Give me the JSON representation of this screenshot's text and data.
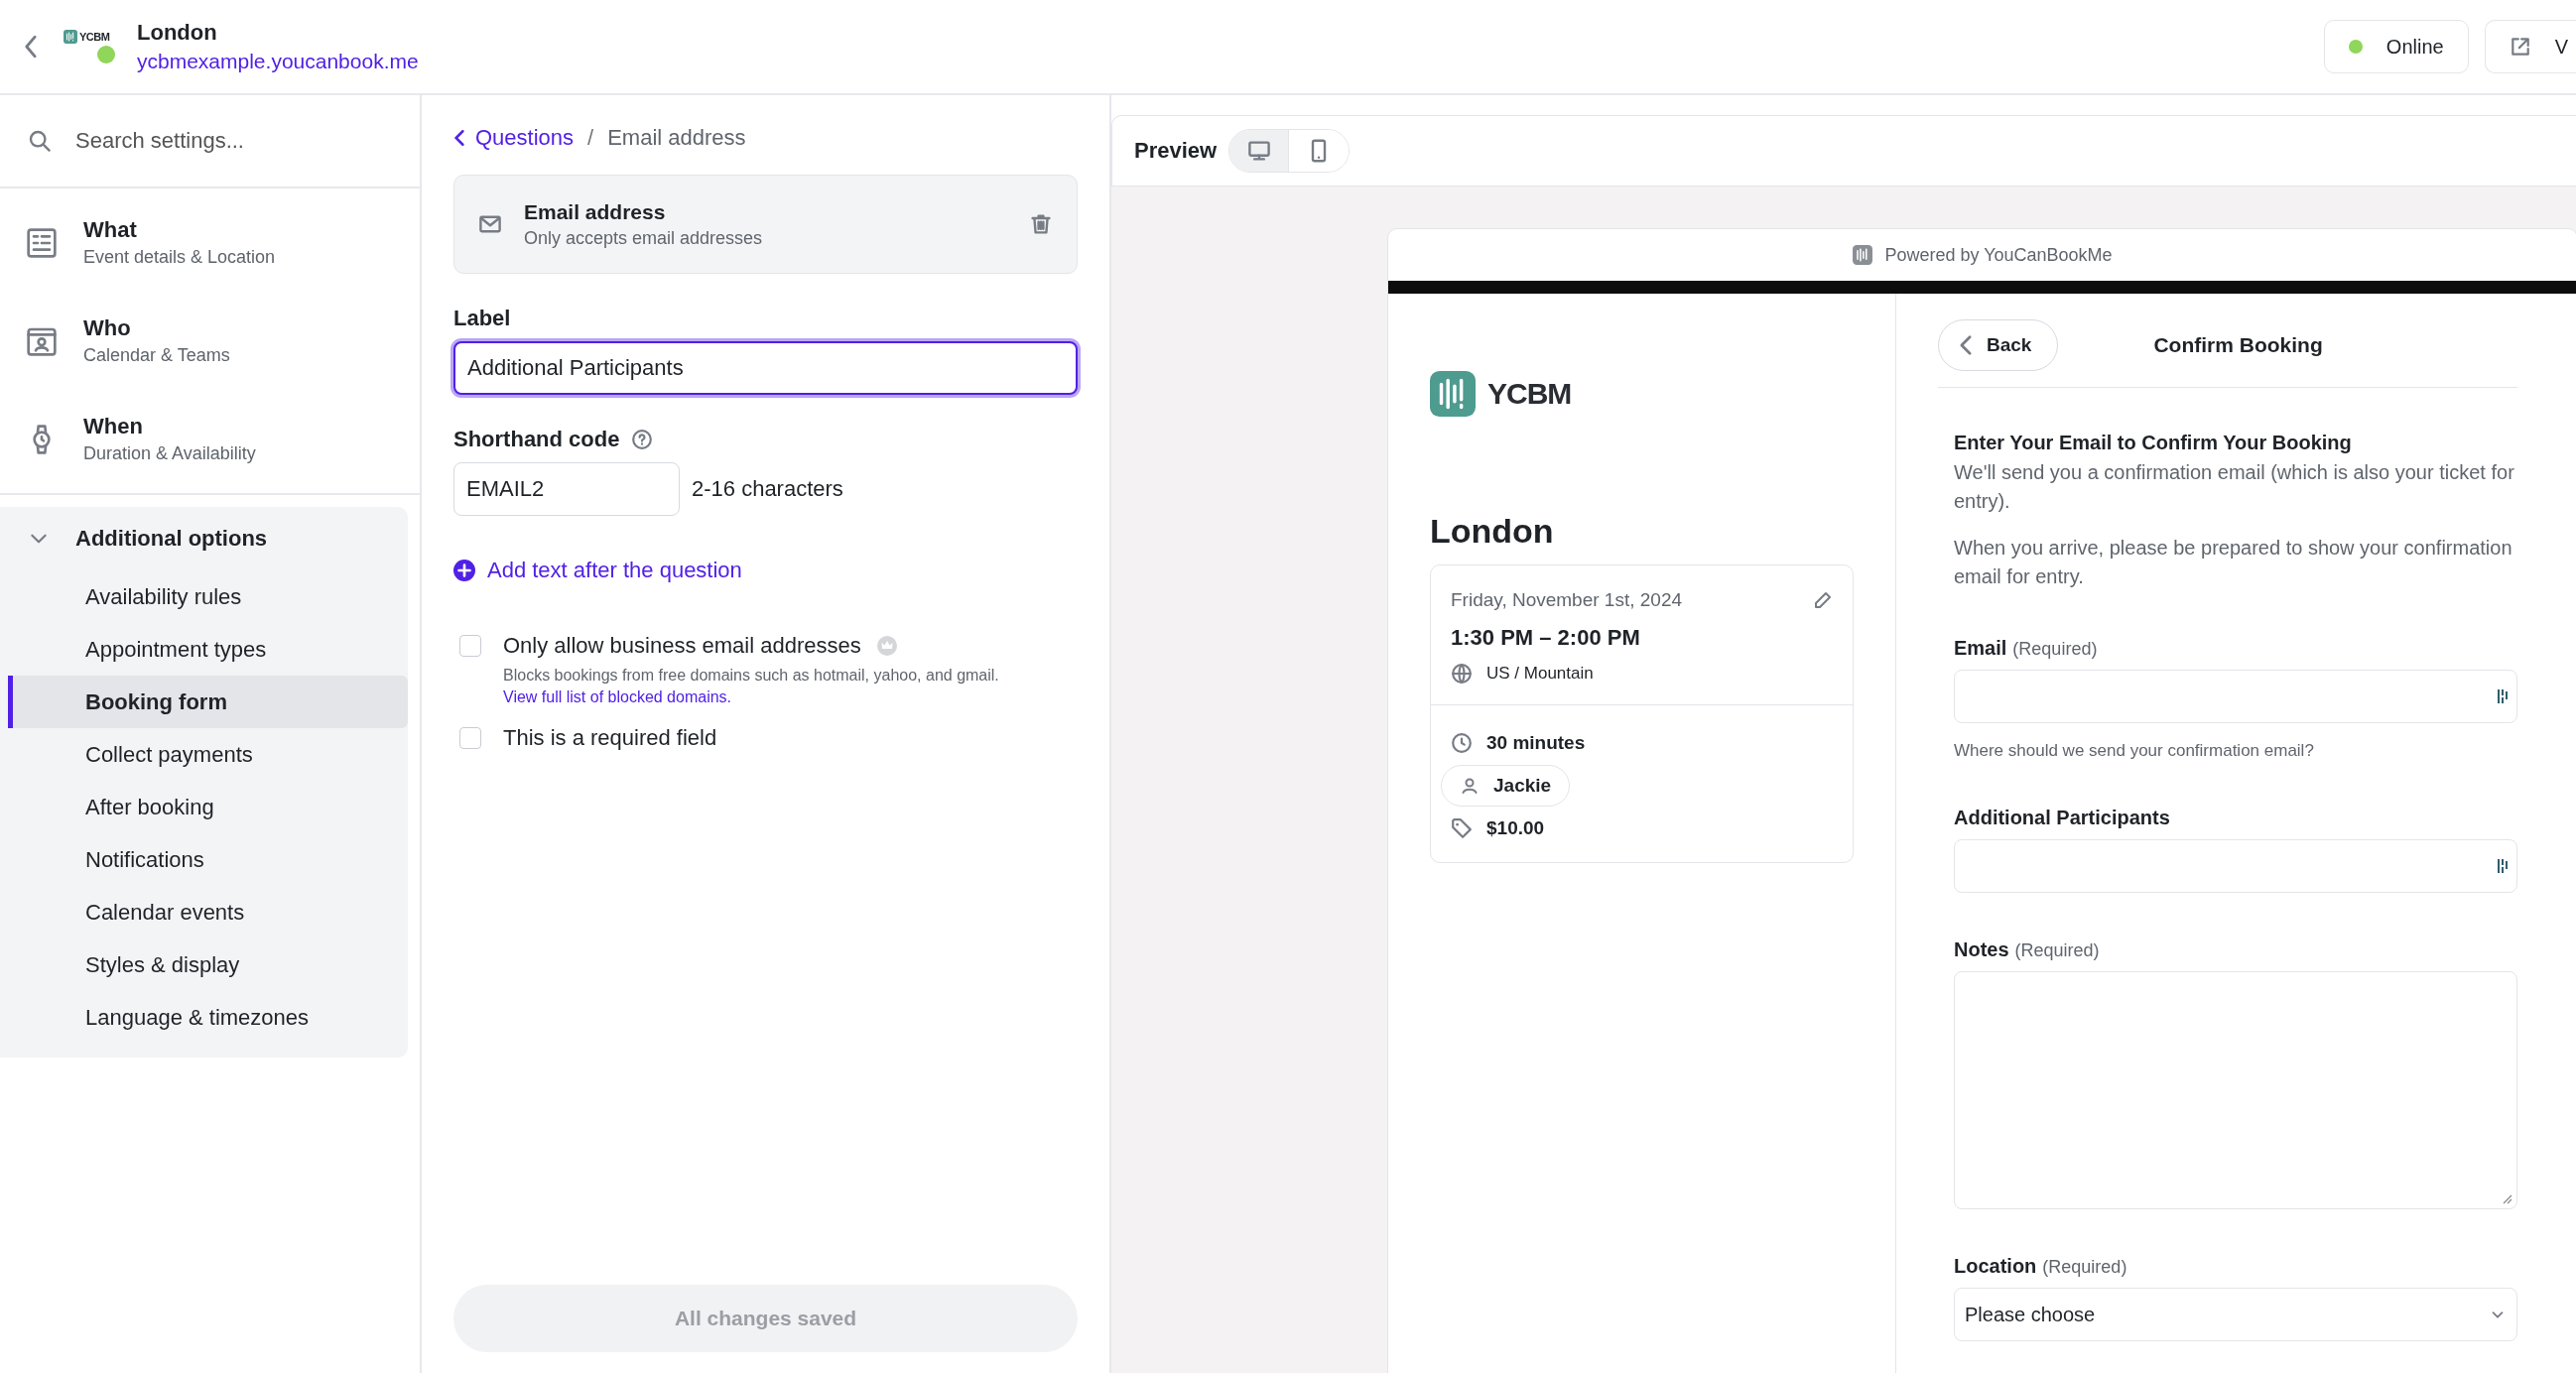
{
  "header": {
    "brand": "YCBM",
    "title": "London",
    "url": "ycbmexample.youcanbook.me",
    "buttons": [
      {
        "kind": "status",
        "label": "Online"
      },
      {
        "kind": "external",
        "label": "V"
      }
    ]
  },
  "sidebar": {
    "search_placeholder": "Search settings...",
    "sections": [
      {
        "kind": "what",
        "title": "What",
        "subtitle": "Event details & Location"
      },
      {
        "kind": "who",
        "title": "Who",
        "subtitle": "Calendar & Teams"
      },
      {
        "kind": "when",
        "title": "When",
        "subtitle": "Duration & Availability"
      }
    ],
    "group": {
      "label": "Additional options",
      "expanded": true,
      "items": [
        {
          "label": "Availability rules",
          "selected": false
        },
        {
          "label": "Appointment types",
          "selected": false
        },
        {
          "label": "Booking form",
          "selected": true
        },
        {
          "label": "Collect payments",
          "selected": false
        },
        {
          "label": "After booking",
          "selected": false
        },
        {
          "label": "Notifications",
          "selected": false
        },
        {
          "label": "Calendar events",
          "selected": false
        },
        {
          "label": "Styles & display",
          "selected": false
        },
        {
          "label": "Language & timezones",
          "selected": false
        }
      ]
    }
  },
  "editor": {
    "breadcrumb": {
      "parent": "Questions",
      "separator": "/",
      "current": "Email address"
    },
    "question_card": {
      "title": "Email address",
      "subtitle": "Only accepts email addresses"
    },
    "label_field": {
      "label": "Label",
      "value": "Additional Participants",
      "focused": true
    },
    "shorthand": {
      "label": "Shorthand code",
      "value": "EMAIL2",
      "hint": "2-16 characters"
    },
    "add_text_link": "Add text after the question",
    "options": [
      {
        "label": "Only allow business email addresses",
        "checked": false,
        "premium": true,
        "description": "Blocks bookings from free domains such as hotmail, yahoo, and gmail.",
        "link": "View full list of blocked domains."
      },
      {
        "label": "This is a required field",
        "checked": false
      }
    ],
    "save_button": {
      "label": "All changes saved",
      "disabled": true
    }
  },
  "preview": {
    "title": "Preview",
    "devices": [
      {
        "kind": "desktop",
        "selected": true
      },
      {
        "kind": "mobile",
        "selected": false
      }
    ],
    "powered_by": "Powered by YouCanBookMe",
    "brand": "YCBM",
    "event": {
      "title": "London",
      "date": "Friday, November 1st, 2024",
      "time": "1:30 PM – 2:00 PM",
      "timezone": "US / Mountain",
      "duration": "30 minutes",
      "host": "Jackie",
      "price": "$10.00"
    },
    "form": {
      "back": "Back",
      "title": "Confirm Booking",
      "heading": "Enter Your Email to Confirm Your Booking",
      "paragraphs": [
        "We'll send you a confirmation email (which is also your ticket for entry).",
        "When you arrive, please be prepared to show your confirmation email for entry."
      ],
      "fields": [
        {
          "kind": "input",
          "label": "Email",
          "note": "(Required)",
          "help": "Where should we send your confirmation email?"
        },
        {
          "kind": "input",
          "label": "Additional Participants"
        },
        {
          "kind": "textarea",
          "label": "Notes",
          "note": "(Required)"
        },
        {
          "kind": "select",
          "label": "Location",
          "note": "(Required)",
          "value": "Please choose"
        }
      ]
    }
  }
}
